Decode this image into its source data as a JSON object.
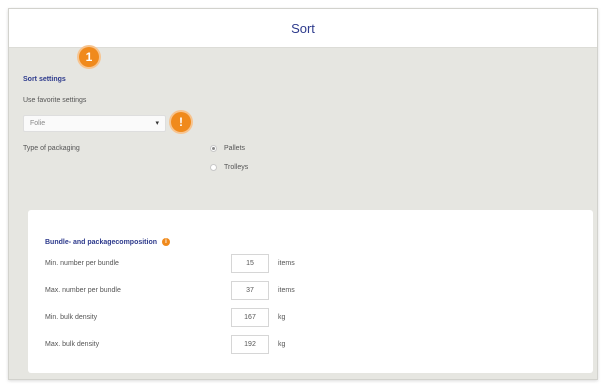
{
  "dialog": {
    "title": "Sort"
  },
  "badges": {
    "step": "1",
    "warning": "!"
  },
  "sort_settings": {
    "heading": "Sort settings",
    "favorite_label": "Use favorite settings",
    "favorite_value": "Folie",
    "packaging_label": "Type of packaging",
    "packaging_options": [
      {
        "label": "Pallets",
        "checked": true
      },
      {
        "label": "Trolleys",
        "checked": false
      }
    ]
  },
  "composition": {
    "heading": "Bundle- and packagecomposition",
    "info_icon": "i",
    "fields": [
      {
        "label": "Min. number per bundle",
        "value": "15",
        "unit": "items"
      },
      {
        "label": "Max. number per bundle",
        "value": "37",
        "unit": "items"
      },
      {
        "label": "Min. bulk density",
        "value": "167",
        "unit": "kg"
      },
      {
        "label": "Max. bulk density",
        "value": "192",
        "unit": "kg"
      }
    ]
  },
  "colors": {
    "accent": "#2d3a8c",
    "badge": "#f08a1c",
    "background": "#e6e6e1"
  },
  "icons": {
    "select_caret": "chevron-down-icon",
    "info": "info-icon"
  }
}
